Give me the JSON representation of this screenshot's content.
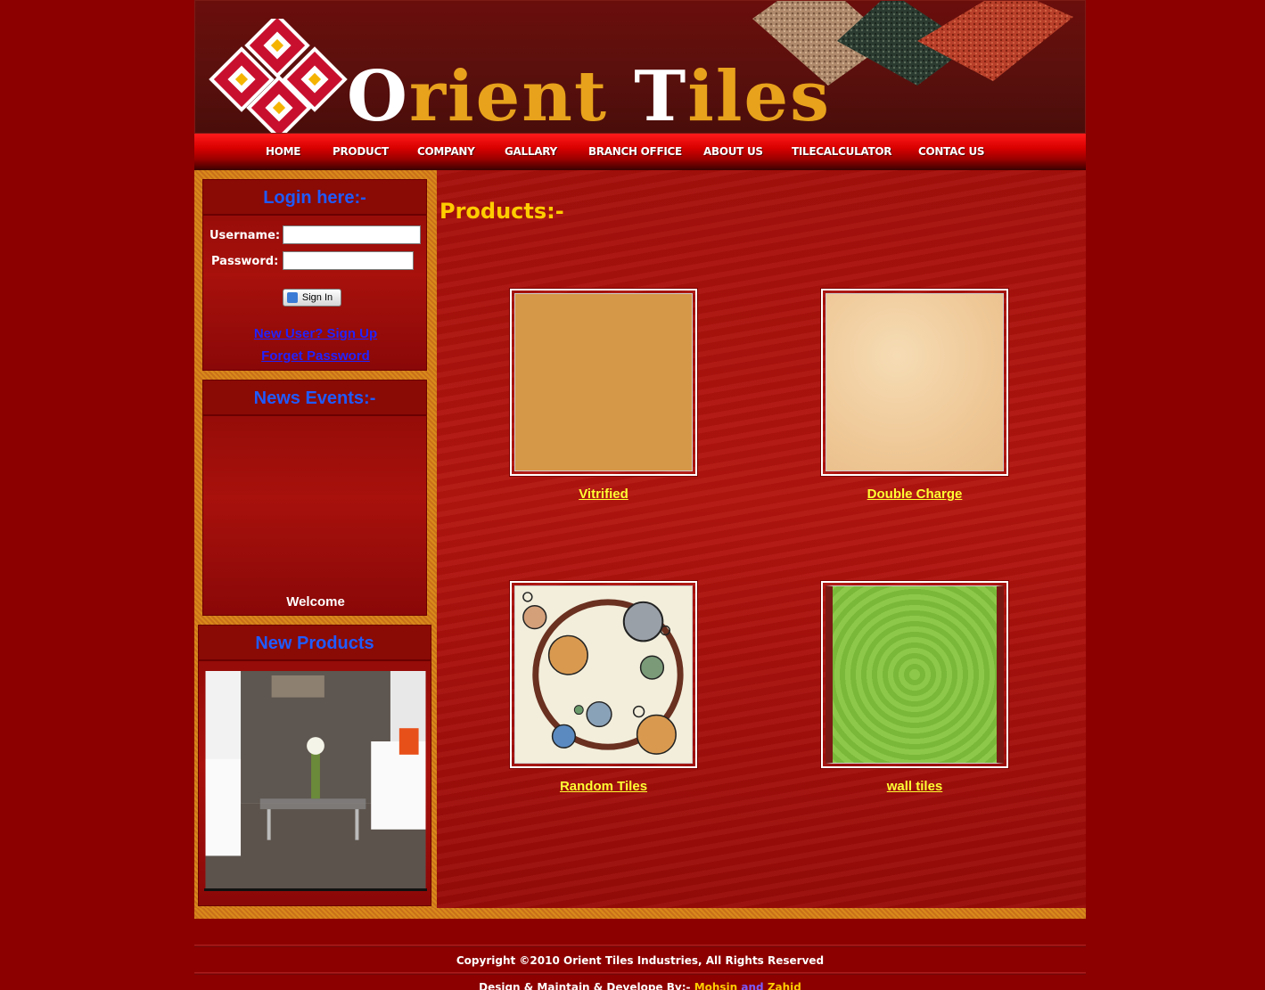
{
  "brand": {
    "name_initial": "O",
    "name_rest": "rient ",
    "name_initial2": "T",
    "name_rest2": "iles"
  },
  "nav": [
    "HOME",
    "PRODUCT",
    "COMPANY",
    "GALLARY",
    "BRANCH OFFICE",
    "ABOUT US",
    "TILECALCULATOR",
    "CONTAC US"
  ],
  "login": {
    "title": "Login here:-",
    "username_label": "Username:",
    "password_label": "Password:",
    "signin_label": "Sign In",
    "signup_link": "New User? Sign Up",
    "forget_link": "Forget Password"
  },
  "news": {
    "title": "News Events:-",
    "welcome": "Welcome"
  },
  "new_products": {
    "title": "New Products"
  },
  "main": {
    "title": "Products:-",
    "products": [
      "Vitrified",
      "Double Charge",
      "Random Tiles",
      "wall tiles"
    ]
  },
  "footer": {
    "copyright": "Copyright ©2010 Orient Tiles Industries, All Rights Reserved",
    "design_prefix": "Design & Maintain & Develope By:-",
    "name1": "Mohsin",
    "and": "and",
    "name2": "Zahid"
  },
  "colors": {
    "accent": "#e8a21c",
    "link": "#2222ff",
    "caption": "#ffff33",
    "title_blue": "#1f5bff"
  }
}
